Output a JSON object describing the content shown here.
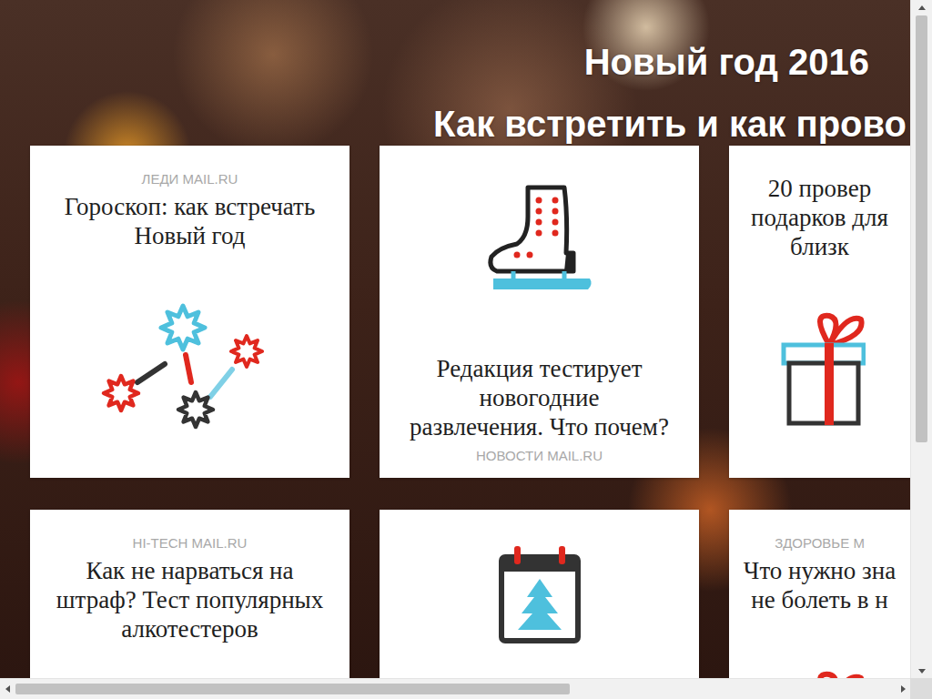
{
  "header": {
    "title": "Новый год 2016",
    "subtitle": "Как встретить и как прово"
  },
  "cards": [
    {
      "kind": "text-first",
      "source": "ЛЕДИ MAIL.RU",
      "lines": [
        "Гороскоп: как встречать",
        "Новый год"
      ]
    },
    {
      "kind": "icon-first",
      "source": "НОВОСТИ MAIL.RU",
      "lines": [
        "Редакция тестирует",
        "новогодние",
        "развлечения. Что почем?"
      ]
    },
    {
      "kind": "text-first",
      "source": "",
      "lines": [
        "20 провер",
        "подарков для",
        "близк"
      ]
    },
    {
      "kind": "text-first",
      "source": "HI-TECH MAIL.RU",
      "lines": [
        "Как не нарваться на",
        "штраф? Тест популярных",
        "алкотестеров"
      ]
    },
    {
      "kind": "icon-first",
      "source": "",
      "lines": []
    },
    {
      "kind": "text-first",
      "source": "ЗДОРОВЬЕ М",
      "lines": [
        "Что нужно зна",
        "не болеть в н"
      ]
    }
  ],
  "scrollbars": {
    "vertical": {
      "level": 0.66,
      "position": 0
    },
    "horizontal": {
      "level": 0.63,
      "position": 0
    }
  }
}
